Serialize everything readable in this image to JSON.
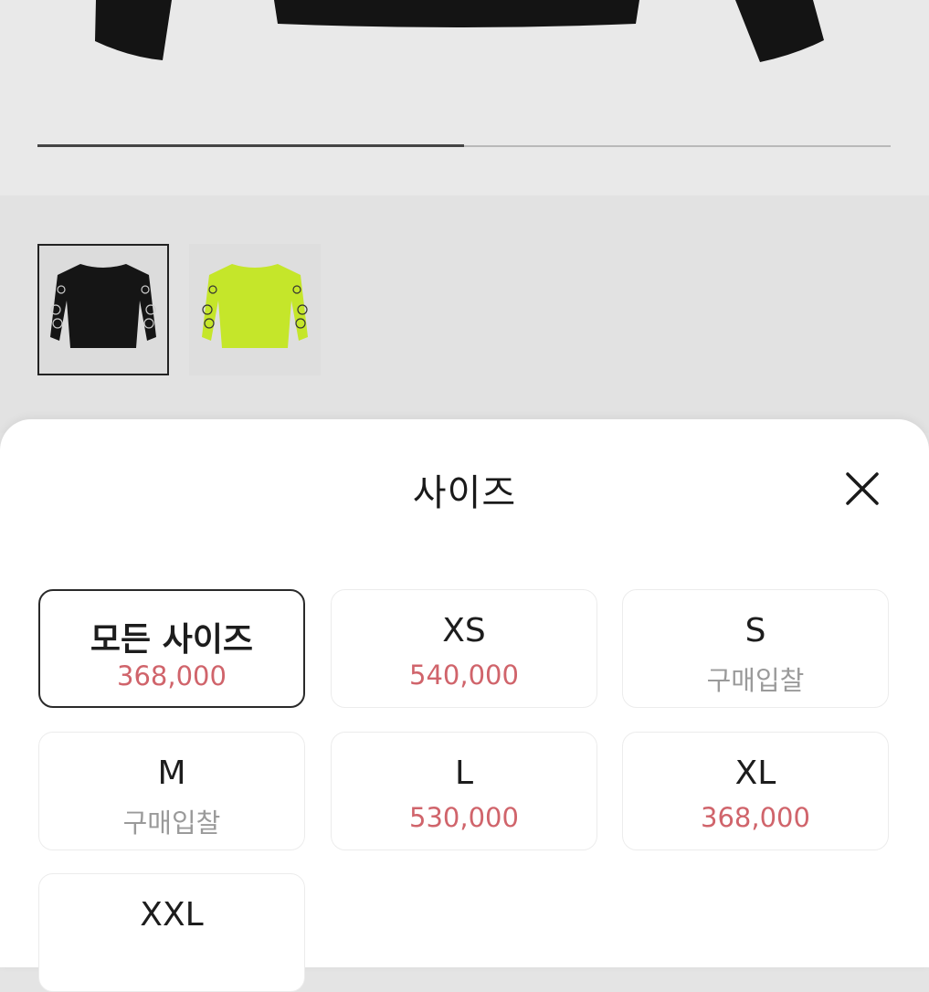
{
  "hero": {
    "image_desc": "black-sweatshirt-image",
    "progress_fraction": 0.5
  },
  "thumbnails": [
    {
      "color_name": "black",
      "color": "#151515",
      "selected": true
    },
    {
      "color_name": "lime",
      "color": "#c5e62a",
      "selected": false
    }
  ],
  "sheet": {
    "title": "사이즈",
    "close_icon": "close-icon"
  },
  "sizes": [
    {
      "label": "모든 사이즈",
      "price": "368,000",
      "active": true
    },
    {
      "label": "XS",
      "price": "540,000"
    },
    {
      "label": "S",
      "price": "구매입찰"
    },
    {
      "label": "M",
      "price": "구매입찰"
    },
    {
      "label": "L",
      "price": "530,000"
    },
    {
      "label": "XL",
      "price": "368,000"
    },
    {
      "label": "XXL",
      "price": ""
    }
  ],
  "colors": {
    "price": "#d0646b",
    "bid": "#9a9a9a",
    "accent_border": "#2a2a2a"
  }
}
